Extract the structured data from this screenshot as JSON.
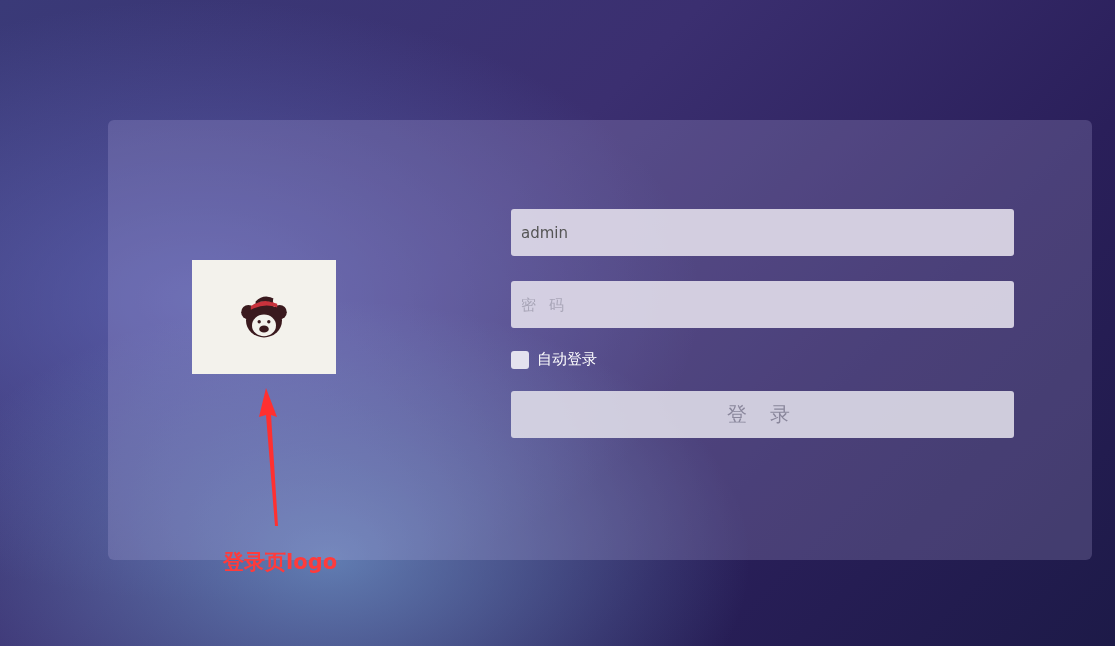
{
  "login_form": {
    "username": {
      "value": "admin"
    },
    "password": {
      "placeholder": "密 码"
    },
    "remember": {
      "label": "自动登录",
      "checked": false
    },
    "submit": {
      "label": "登 录"
    }
  },
  "annotation": {
    "text": "登录页logo"
  }
}
